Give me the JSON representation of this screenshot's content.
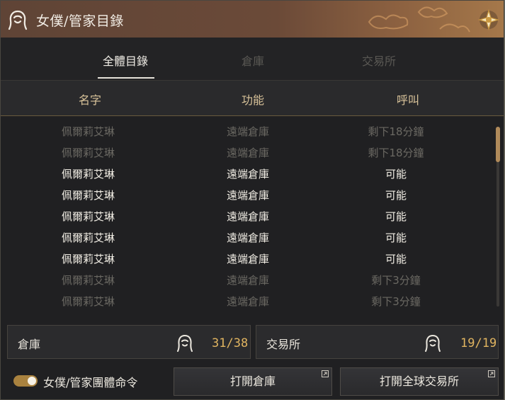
{
  "window": {
    "title": "女僕/管家目錄",
    "title_icon": "maid-icon",
    "emblem_icon": "compass-emblem-icon"
  },
  "tabs": [
    {
      "label": "全體目錄",
      "active": true
    },
    {
      "label": "倉庫",
      "active": false
    },
    {
      "label": "交易所",
      "active": false
    }
  ],
  "columns": [
    "名字",
    "功能",
    "呼叫"
  ],
  "rows": [
    {
      "name": "佩爾莉艾琳",
      "function": "遠端倉庫",
      "call": "剩下18分鐘",
      "available": false
    },
    {
      "name": "佩爾莉艾琳",
      "function": "遠端倉庫",
      "call": "剩下18分鐘",
      "available": false
    },
    {
      "name": "佩爾莉艾琳",
      "function": "遠端倉庫",
      "call": "可能",
      "available": true
    },
    {
      "name": "佩爾莉艾琳",
      "function": "遠端倉庫",
      "call": "可能",
      "available": true
    },
    {
      "name": "佩爾莉艾琳",
      "function": "遠端倉庫",
      "call": "可能",
      "available": true
    },
    {
      "name": "佩爾莉艾琳",
      "function": "遠端倉庫",
      "call": "可能",
      "available": true
    },
    {
      "name": "佩爾莉艾琳",
      "function": "遠端倉庫",
      "call": "可能",
      "available": true
    },
    {
      "name": "佩爾莉艾琳",
      "function": "遠端倉庫",
      "call": "剩下3分鐘",
      "available": false
    },
    {
      "name": "佩爾莉艾琳",
      "function": "遠端倉庫",
      "call": "剩下3分鐘",
      "available": false
    }
  ],
  "summary": {
    "warehouse": {
      "label": "倉庫",
      "count": "31/38",
      "icon": "maid-icon"
    },
    "market": {
      "label": "交易所",
      "count": "19/19",
      "icon": "maid-icon"
    }
  },
  "footer": {
    "toggle_label": "女僕/管家團體命令",
    "toggle_on": true,
    "open_warehouse_label": "打開倉庫",
    "open_market_label": "打開全球交易所",
    "popout_icon": "popout-icon"
  },
  "colors": {
    "accent": "#e0b460",
    "header_text": "#d9c39a",
    "toggle": "#a9823f",
    "scroll_thumb": "#b08a5a"
  }
}
